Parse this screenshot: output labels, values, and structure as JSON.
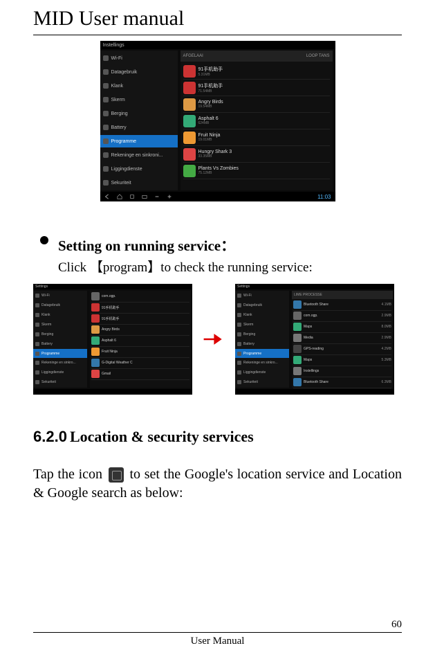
{
  "header": {
    "title": "MID User manual"
  },
  "screenshot1": {
    "statusbar_title": "Instellings",
    "sidebar": [
      {
        "label": "Wi-Fi"
      },
      {
        "label": "Datagebruik"
      },
      {
        "label": "Klank"
      },
      {
        "label": "Skerm"
      },
      {
        "label": "Berging"
      },
      {
        "label": "Battery"
      },
      {
        "label": "Programme",
        "active": true
      },
      {
        "label": "Rekeninge en sinkroni..."
      },
      {
        "label": "Liggingdienste"
      },
      {
        "label": "Sekuriteit"
      }
    ],
    "tabs": {
      "left": "AFGELAAI",
      "right": "LOOP TANS"
    },
    "apps": [
      {
        "name": "91手机助手",
        "sub": "5.31MB",
        "color": "#c33"
      },
      {
        "name": "91手机助手",
        "sub": "71.54MB",
        "color": "#c33"
      },
      {
        "name": "Angry Birds",
        "sub": "19.54MB",
        "color": "#d94"
      },
      {
        "name": "Asphalt 6",
        "sub": "624MB",
        "color": "#3a7"
      },
      {
        "name": "Fruit Ninja",
        "sub": "19.01MB",
        "color": "#e93"
      },
      {
        "name": "Hungry Shark 3",
        "sub": "33.35MB",
        "color": "#d44"
      },
      {
        "name": "Plants Vs Zombies",
        "sub": "75.12MB",
        "color": "#4a4"
      }
    ],
    "clock": "11:03"
  },
  "bullet": {
    "title": "Setting on running service：",
    "desc_pre": "Click 【",
    "desc_mid": "program",
    "desc_post": "】to check the running service:"
  },
  "screenshot_left": {
    "title": "Settings",
    "sidebar": [
      {
        "label": "Wi-Fi"
      },
      {
        "label": "Datagebruik"
      },
      {
        "label": "Klank"
      },
      {
        "label": "Skerm"
      },
      {
        "label": "Berging"
      },
      {
        "label": "Battery"
      },
      {
        "label": "Programme",
        "active": true
      },
      {
        "label": "Rekeninge en sinkro..."
      },
      {
        "label": "Liggingdienste"
      },
      {
        "label": "Sekuriteit"
      }
    ],
    "apps": [
      {
        "name": "com.ogp.",
        "color": "#666"
      },
      {
        "name": "91手机助手",
        "color": "#c33"
      },
      {
        "name": "91手机助手",
        "color": "#c33"
      },
      {
        "name": "Angry Birds",
        "color": "#d94"
      },
      {
        "name": "Asphalt 6",
        "color": "#3a7"
      },
      {
        "name": "Fruit Ninja",
        "color": "#e93"
      },
      {
        "name": "G-Digital Weather C",
        "color": "#37a"
      },
      {
        "name": "Gmail",
        "color": "#d44"
      }
    ]
  },
  "screenshot_right": {
    "title": "Settings",
    "header": "LIME PROCESSE",
    "sidebar": [
      {
        "label": "Wi-Fi"
      },
      {
        "label": "Datagebruik"
      },
      {
        "label": "Klank"
      },
      {
        "label": "Skerm"
      },
      {
        "label": "Berging"
      },
      {
        "label": "Battery"
      },
      {
        "label": "Programme",
        "active": true
      },
      {
        "label": "Rekeninge en sinkro..."
      },
      {
        "label": "Liggingdienste"
      },
      {
        "label": "Sekuriteit"
      }
    ],
    "services": [
      {
        "name": "Bluetooth Share",
        "val": "4.1MB",
        "color": "#37a"
      },
      {
        "name": "com.ogp.",
        "val": "2.9MB",
        "color": "#666"
      },
      {
        "name": "Maps",
        "val": "8.0MB",
        "color": "#3a7"
      },
      {
        "name": "Media",
        "val": "2.9MB",
        "color": "#777"
      },
      {
        "name": "GPS-reading",
        "val": "4.2MB",
        "color": "#444"
      },
      {
        "name": "Maps",
        "val": "5.3MB",
        "color": "#3a7"
      },
      {
        "name": "Instellings",
        "val": "",
        "color": "#777"
      },
      {
        "name": "Bluetooth Share",
        "val": "6.3MB",
        "color": "#37a"
      }
    ]
  },
  "section": {
    "num": "6.2.0",
    "title": "Location & security services"
  },
  "body": {
    "pre": "Tap the icon ",
    "post": " to set the Google's location service and Location & Google search as below:"
  },
  "footer": {
    "page": "60",
    "label": "User Manual"
  }
}
